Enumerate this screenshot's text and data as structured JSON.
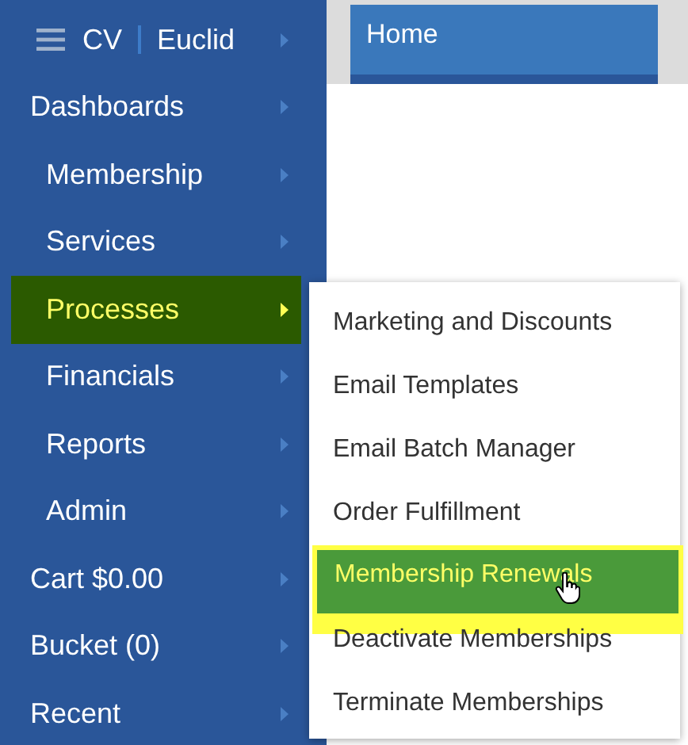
{
  "sidebar": {
    "brand": {
      "short": "CV",
      "name": "Euclid"
    },
    "items": [
      {
        "label": "Dashboards",
        "selected": false,
        "children": [
          {
            "label": "Membership",
            "selected": false
          },
          {
            "label": "Services",
            "selected": false
          },
          {
            "label": "Processes",
            "selected": true
          },
          {
            "label": "Financials",
            "selected": false
          },
          {
            "label": "Reports",
            "selected": false
          },
          {
            "label": "Admin",
            "selected": false
          }
        ]
      },
      {
        "label": "Cart $0.00",
        "selected": false
      },
      {
        "label": "Bucket (0)",
        "selected": false
      },
      {
        "label": "Recent",
        "selected": false
      }
    ]
  },
  "tabs": [
    {
      "label": "Home"
    }
  ],
  "submenu": {
    "items": [
      {
        "label": "Marketing and Discounts",
        "selected": false
      },
      {
        "label": "Email Templates",
        "selected": false
      },
      {
        "label": "Email Batch Manager",
        "selected": false
      },
      {
        "label": "Order Fulfillment",
        "selected": false
      },
      {
        "label": "Membership Renewals",
        "selected": true
      },
      {
        "label": "Deactivate Memberships",
        "selected": false
      },
      {
        "label": "Terminate Memberships",
        "selected": false
      }
    ]
  }
}
